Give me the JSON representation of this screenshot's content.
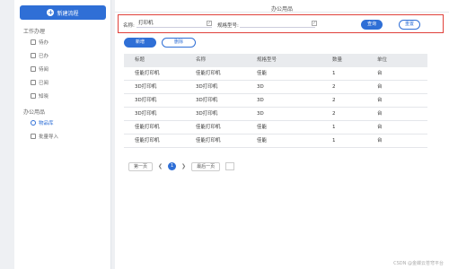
{
  "sidebar": {
    "new_button_label": "新建流程",
    "group_work": "工作办理",
    "work_items": [
      {
        "label": "待办"
      },
      {
        "label": "已办"
      },
      {
        "label": "待阅"
      },
      {
        "label": "已阅"
      },
      {
        "label": "知晓"
      }
    ],
    "group_office": "办公用品",
    "office_items": [
      {
        "label": "物品库"
      },
      {
        "label": "批量导入"
      }
    ]
  },
  "main": {
    "title": "办公用品",
    "filter": {
      "name_label": "名称:",
      "name_value": "打印机",
      "model_label": "规格型号:",
      "model_value": "",
      "query_label": "查询",
      "reset_label": "重置"
    },
    "add_label": "新增",
    "delete_label": "删除",
    "table": {
      "headers": [
        "标题",
        "名称",
        "规格型号",
        "数量",
        "单位"
      ],
      "rows": [
        [
          "佳能打印机",
          "佳能打印机",
          "佳能",
          "1",
          "台"
        ],
        [
          "3D打印机",
          "3D打印机",
          "3D",
          "2",
          "台"
        ],
        [
          "3D打印机",
          "3D打印机",
          "3D",
          "2",
          "台"
        ],
        [
          "3D打印机",
          "3D打印机",
          "3D",
          "2",
          "台"
        ],
        [
          "佳能打印机",
          "佳能打印机",
          "佳能",
          "1",
          "台"
        ],
        [
          "佳能打印机",
          "佳能打印机",
          "佳能",
          "1",
          "台"
        ]
      ]
    },
    "pager": {
      "first_label": "第一页",
      "current_page": "1",
      "last_label": "最后一页"
    }
  },
  "watermark": "CSDN @金蝶云苍穹平台",
  "colors": {
    "accent": "#2f6fd6",
    "highlight_border": "#e0403a"
  }
}
